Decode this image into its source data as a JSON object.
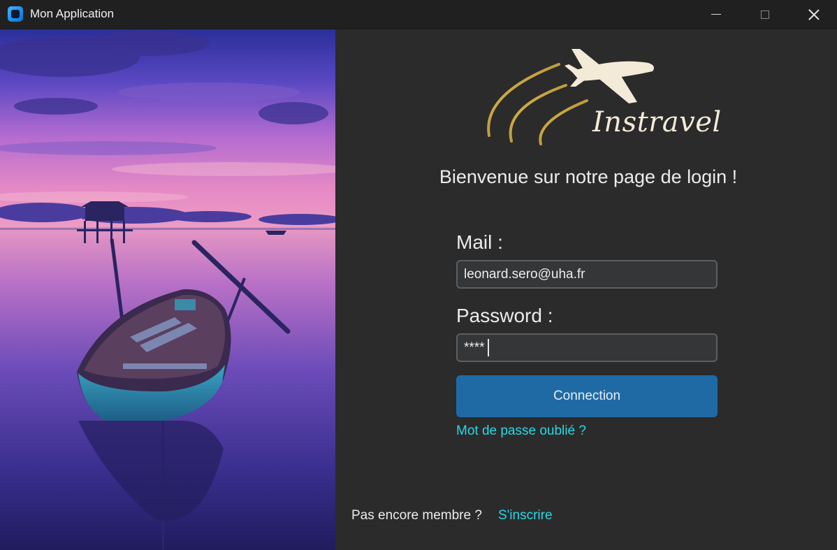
{
  "window": {
    "title": "Mon Application"
  },
  "logo": {
    "text": "Instravel"
  },
  "login": {
    "welcome": "Bienvenue sur notre page de login !",
    "mail_label": "Mail :",
    "mail_value": "leonard.sero@uha.fr",
    "password_label": "Password :",
    "password_value": "****",
    "connect_label": "Connection",
    "forgot_label": "Mot de passe oublié ?",
    "signup_prompt": "Pas encore membre ?",
    "signup_label": "S'inscrire"
  },
  "colors": {
    "panel_bg": "#2b2b2b",
    "button_bg": "#1f6aa5",
    "link": "#27d9e6",
    "logo_gold": "#c9a23a",
    "logo_cream": "#f3ead8"
  }
}
